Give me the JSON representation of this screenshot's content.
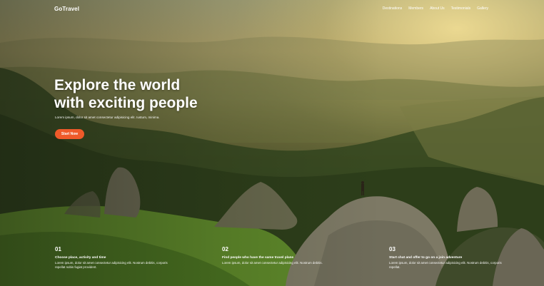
{
  "nav": {
    "logo": "GoTravel",
    "links": [
      "Destinations",
      "Members",
      "About Us",
      "Testimonials",
      "Gallery"
    ]
  },
  "hero": {
    "title_line1": "Explore the world",
    "title_line2": "with exciting people",
    "subtitle": "Lorem ipsum, dolor sit amet consectetur adipisicing elit. Iustum, minima.",
    "cta_label": "Start Now"
  },
  "steps": [
    {
      "number": "01",
      "title": "Choose place, activity and time",
      "description": "Lorem ipsum, dolor sit amet consectetur adipisicing elit. Nostrum debitis, corporis repellat nobis fugiat provident."
    },
    {
      "number": "02",
      "title": "Find people who have the same travel plans",
      "description": "Lorem ipsum, dolor sit amet consectetur adipisicing elit. Nostrum debitis."
    },
    {
      "number": "03",
      "title": "Start chat and offer to go on a join adventure",
      "description": "Lorem ipsum, dolor sit amet consectetur adipisicing elit. Nostrum debitis, corporis repellat."
    }
  ],
  "colors": {
    "accent": "#ef5a2a",
    "text": "#ffffff"
  }
}
